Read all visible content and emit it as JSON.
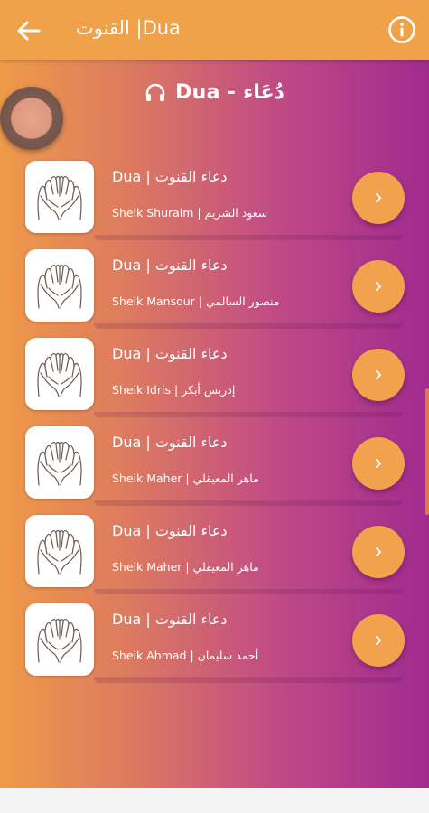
{
  "appbar": {
    "title": "القنوت |Dua",
    "back_icon": "arrow-left-icon",
    "info_icon": "info-circle-icon"
  },
  "section": {
    "title": "Dua - دُعَاء",
    "icon": "headphones-icon"
  },
  "items": [
    {
      "title": "Dua | دعاء القنوت",
      "subtitle": "Sheik Shuraim | سعود الشريم"
    },
    {
      "title": "Dua | دعاء القنوت",
      "subtitle": "Sheik Mansour | منصور السالمي"
    },
    {
      "title": "Dua | دعاء القنوت",
      "subtitle": "Sheik Idris | إدريس أبكر"
    },
    {
      "title": "Dua | دعاء القنوت",
      "subtitle": "Sheik Maher | ماهر المعيقلي"
    },
    {
      "title": "Dua | دعاء القنوت",
      "subtitle": "Sheik Maher | ماهر المعيقلي"
    },
    {
      "title": "Dua | دعاء القنوت",
      "subtitle": "Sheik Ahmad | أحمد سليمان"
    }
  ],
  "colors": {
    "appbar": "#f0a24a",
    "gradient_start": "#ef9a48",
    "gradient_end": "#a12a8f",
    "play_button": "#f2a14c"
  }
}
